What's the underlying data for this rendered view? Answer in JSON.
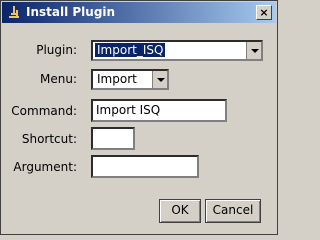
{
  "window": {
    "title": "Install Plugin",
    "close_glyph": "×"
  },
  "form": {
    "plugin_label": "Plugin:",
    "plugin_value": "Import_ISQ",
    "menu_label": "Menu:",
    "menu_value": "Import",
    "command_label": "Command:",
    "command_value": "Import ISQ",
    "shortcut_label": "Shortcut:",
    "shortcut_value": "",
    "argument_label": "Argument:",
    "argument_value": ""
  },
  "buttons": {
    "ok": "OK",
    "cancel": "Cancel"
  }
}
